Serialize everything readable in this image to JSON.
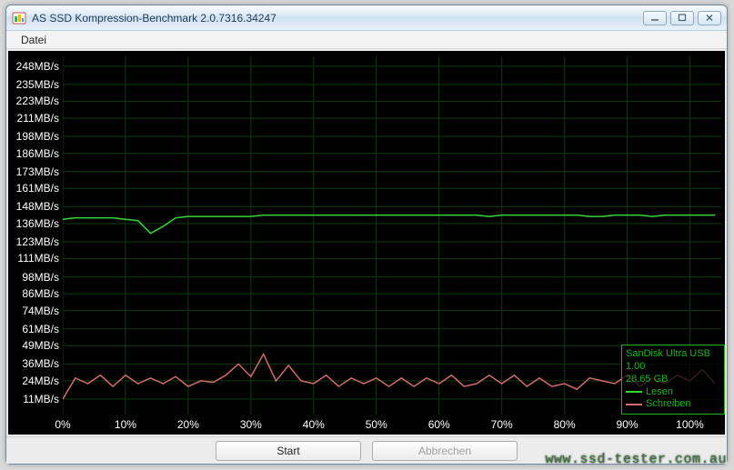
{
  "window": {
    "title": "AS SSD Kompression-Benchmark 2.0.7316.34247"
  },
  "menu": {
    "file": "Datei"
  },
  "buttons": {
    "start": "Start",
    "cancel": "Abbrechen"
  },
  "info": {
    "device": "SanDisk Ultra USB",
    "firmware": "1.00",
    "capacity": "28,65 GB",
    "legend_read": "Lesen",
    "legend_write": "Schreiben"
  },
  "watermark": "www.ssd-tester.com.au",
  "chart_data": {
    "type": "line",
    "xlabel": "",
    "ylabel": "",
    "y_unit": "MB/s",
    "x_unit": "%",
    "ylim": [
      0,
      255
    ],
    "xlim": [
      0,
      105
    ],
    "y_ticks": [
      11,
      24,
      36,
      49,
      61,
      74,
      86,
      98,
      111,
      123,
      136,
      148,
      161,
      173,
      186,
      198,
      211,
      223,
      235,
      248
    ],
    "x_ticks": [
      0,
      10,
      20,
      30,
      40,
      50,
      60,
      70,
      80,
      90,
      100
    ],
    "x": [
      0,
      2,
      4,
      6,
      8,
      10,
      12,
      14,
      16,
      18,
      20,
      22,
      24,
      26,
      28,
      30,
      32,
      34,
      36,
      38,
      40,
      42,
      44,
      46,
      48,
      50,
      52,
      54,
      56,
      58,
      60,
      62,
      64,
      66,
      68,
      70,
      72,
      74,
      76,
      78,
      80,
      82,
      84,
      86,
      88,
      90,
      92,
      94,
      96,
      98,
      100,
      102,
      104
    ],
    "series": [
      {
        "name": "Lesen",
        "color": "#34d834",
        "values": [
          139,
          140,
          140,
          140,
          140,
          139,
          138,
          129,
          134,
          140,
          141,
          141,
          141,
          141,
          141,
          141,
          142,
          142,
          142,
          142,
          142,
          142,
          142,
          142,
          142,
          142,
          142,
          142,
          142,
          142,
          142,
          142,
          142,
          142,
          141,
          142,
          142,
          142,
          142,
          142,
          142,
          142,
          141,
          141,
          142,
          142,
          142,
          141,
          142,
          142,
          142,
          142,
          142
        ]
      },
      {
        "name": "Schreiben",
        "color": "#d26b6b",
        "values": [
          11,
          26,
          22,
          28,
          20,
          28,
          22,
          26,
          22,
          27,
          20,
          24,
          23,
          28,
          36,
          27,
          43,
          24,
          35,
          24,
          22,
          28,
          20,
          26,
          22,
          26,
          20,
          26,
          20,
          26,
          22,
          28,
          20,
          22,
          28,
          22,
          28,
          20,
          26,
          20,
          22,
          18,
          26,
          24,
          22,
          28,
          20,
          26,
          22,
          28,
          24,
          32,
          22
        ]
      }
    ]
  }
}
